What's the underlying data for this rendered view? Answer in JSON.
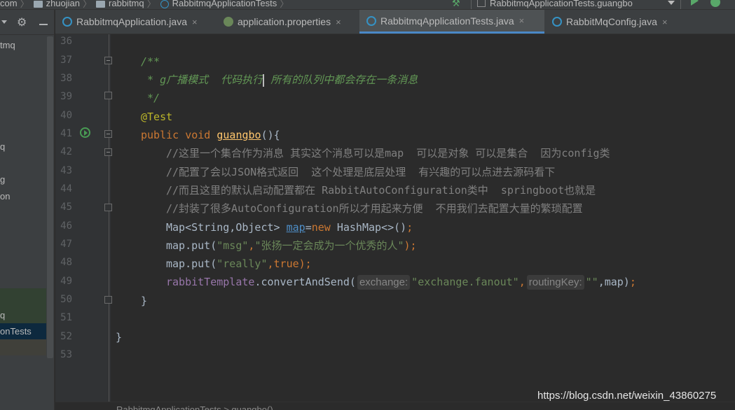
{
  "breadcrumbs": [
    {
      "label": "com",
      "icon": "folder-icon"
    },
    {
      "label": "zhuojian",
      "icon": "folder-icon"
    },
    {
      "label": "rabbitmq",
      "icon": "folder-icon"
    },
    {
      "label": "RabbitmqApplicationTests",
      "icon": "class-icon"
    }
  ],
  "run_config": {
    "label": "RabbitmqApplicationTests.guangbo"
  },
  "project_tree": {
    "items": [
      "tmq",
      "q",
      "g",
      "on",
      "q",
      "onTests"
    ]
  },
  "tabs": [
    {
      "label": "RabbitmqApplication.java",
      "close": "×"
    },
    {
      "label": "application.properties",
      "close": "×"
    },
    {
      "label": "RabbitmqApplicationTests.java",
      "close": "×"
    },
    {
      "label": "RabbitMqConfig.java",
      "close": "×"
    }
  ],
  "line_numbers": [
    "36",
    "37",
    "38",
    "39",
    "40",
    "41",
    "42",
    "43",
    "44",
    "45",
    "46",
    "47",
    "48",
    "49",
    "50",
    "51",
    "52",
    "53"
  ],
  "code": {
    "l37": "/**",
    "l38a": " * g广播模式  代码执行",
    "l38b": " 所有的队列中都会存在一条消息",
    "l39": " */",
    "l40": "@Test",
    "l41_kw": "public void ",
    "l41_fn": "guangbo",
    "l41_rest": "(){",
    "l42": "//这里一个集合作为消息 其实这个消息可以是map  可以是对象 可以是集合  因为config类",
    "l43": "//配置了会以JSON格式返回  这个处理是底层处理  有兴趣的可以点进去源码看下",
    "l44": "//而且这里的默认启动配置都在 RabbitAutoConfiguration类中  springboot也就是",
    "l45": "//封装了很多AutoConfiguration所以才用起来方便  不用我们去配置大量的繁琐配置",
    "l46_a": "Map<String,Object> ",
    "l46_var": "map",
    "l46_b": "=",
    "l46_kw": "new ",
    "l46_c": "HashMap<>()",
    "l46_semi": ";",
    "l47_a": "map.put(",
    "l47_s1": "\"msg\"",
    "l47_comma": ",",
    "l47_s2": "\"张扬一定会成为一个优秀的人\"",
    "l47_end": ");",
    "l48_a": "map.put(",
    "l48_s1": "\"really\"",
    "l48_comma": ",",
    "l48_kw": "true",
    "l48_end": ");",
    "l49_fld": "rabbitTemplate",
    "l49_a": ".convertAndSend(",
    "l49_hint1": "exchange:",
    "l49_s1": "\"exchange.fanout\"",
    "l49_comma": ",",
    "l49_hint2": "routingKey:",
    "l49_s2": "\"\"",
    "l49_b": ",map)",
    "l49_semi": ";",
    "l50": "}",
    "l52": "}"
  },
  "bottom_breadcrumb": "RabbitmqApplicationTests  >  guangbo()",
  "watermark": "https://blog.csdn.net/weixin_43860275",
  "colors": {
    "accent": "#4a88c7",
    "string": "#6a8759",
    "keyword": "#cc7832",
    "comment": "#808080",
    "doc": "#629755",
    "annotation": "#bbb529",
    "method": "#ffc66d",
    "field": "#9876aa"
  }
}
